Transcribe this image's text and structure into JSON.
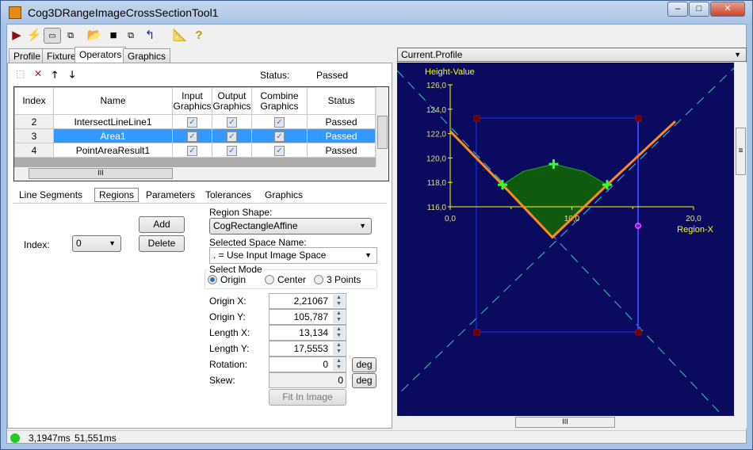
{
  "window": {
    "title": "Cog3DRangeImageCrossSectionTool1",
    "minimize": "–",
    "maximize": "□",
    "close": "✕"
  },
  "toolbar": {
    "icons": [
      "run-icon",
      "electric-run-icon",
      "show-panel-icon",
      "floating-panel-icon",
      "open-icon",
      "save-icon",
      "save-settings-icon",
      "reset-icon",
      "calibration-icon",
      "help-icon"
    ]
  },
  "tabs": [
    "Profile",
    "Fixture",
    "Operators",
    "Graphics"
  ],
  "operators": {
    "status_label": "Status:",
    "status_value": "Passed",
    "columns": [
      "Index",
      "Name",
      "Input Graphics",
      "Output Graphics",
      "Combine Graphics",
      "Status"
    ],
    "rows": [
      {
        "index": "2",
        "name": "IntersectLineLine1",
        "input": true,
        "output": true,
        "combine": true,
        "status": "Passed"
      },
      {
        "index": "3",
        "name": "Area1",
        "input": true,
        "output": true,
        "combine": true,
        "status": "Passed",
        "selected": true
      },
      {
        "index": "4",
        "name": "PointAreaResult1",
        "input": true,
        "output": true,
        "combine": true,
        "status": "Passed"
      }
    ],
    "hscroll_grip": "III"
  },
  "subtabs": [
    "Line Segments",
    "Regions",
    "Parameters",
    "Tolerances",
    "Graphics"
  ],
  "regions": {
    "add": "Add",
    "delete": "Delete",
    "index_label": "Index:",
    "index_value": "0",
    "shape_label": "Region Shape:",
    "shape_value": "CogRectangleAffine",
    "space_label": "Selected Space Name:",
    "space_value": ". = Use Input Image Space",
    "mode_label": "Select Mode",
    "modes": [
      "Origin",
      "Center",
      "3 Points"
    ],
    "mode_selected": "Origin",
    "fields": [
      {
        "label": "Origin X:",
        "value": "2,21067"
      },
      {
        "label": "Origin Y:",
        "value": "105,787"
      },
      {
        "label": "Length X:",
        "value": "13,134"
      },
      {
        "label": "Length Y:",
        "value": "17,5553"
      },
      {
        "label": "Rotation:",
        "value": "0",
        "unit": "deg"
      },
      {
        "label": "Skew:",
        "value": "0",
        "unit": "deg"
      }
    ],
    "fit": "Fit In Image"
  },
  "display": {
    "selector": "Current.Profile",
    "hscroll_grip": "III",
    "vscroll_grip": "≡"
  },
  "status": {
    "time1": "3,1947ms",
    "time2": "51,551ms",
    "indicator_color": "#22cc22"
  },
  "chart_data": {
    "type": "line",
    "xlabel": "Region-X",
    "ylabel": "Height-Value",
    "xlim": [
      0,
      20
    ],
    "ylim": [
      116,
      126
    ],
    "xticks": [
      "0,0",
      "10,0",
      "20,0"
    ],
    "yticks": [
      "116,0",
      "118,0",
      "120,0",
      "122,0",
      "124,0",
      "126,0"
    ],
    "background": "#0a0a5e",
    "axis_color": "#ffff00",
    "profile_color": "#ff8c1a",
    "area_color": "#1a8c1a",
    "series": [
      {
        "x": [
          0,
          4.3,
          8.4,
          12.9,
          18.5
        ],
        "y": [
          122.2,
          117.8,
          113.5,
          117.8,
          123.0
        ]
      }
    ],
    "area_top": {
      "x": [
        4.3,
        6,
        8.5,
        11,
        12.9
      ],
      "y": [
        117.8,
        118.9,
        119.5,
        118.9,
        117.8
      ]
    },
    "points": [
      {
        "x": 4.3,
        "y": 117.8
      },
      {
        "x": 8.5,
        "y": 119.5
      },
      {
        "x": 12.9,
        "y": 117.8
      }
    ]
  }
}
